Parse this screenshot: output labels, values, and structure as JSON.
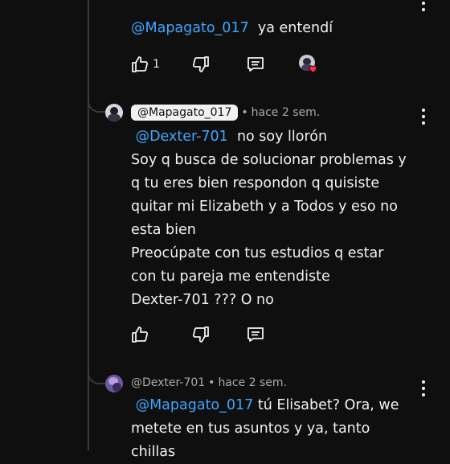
{
  "comments": [
    {
      "mention": "@Mapagato_017",
      "text": "ya entendí",
      "like_count": "1"
    },
    {
      "handle": "@Mapagato_017",
      "time": "hace 2 sem.",
      "mention": "@Dexter-701",
      "first_line_rest": "no soy llorón",
      "lines": [
        "Soy q busca de solucionar problemas y",
        "q tu eres bien respondon q quisiste",
        "quitar mi Elizabeth y a Todos y eso no",
        "esta bien",
        "Preocúpate con tus estudios q estar",
        "con tu pareja me entendiste",
        "Dexter-701 ??? O no"
      ]
    },
    {
      "handle": "@Dexter-701",
      "time": "hace 2 sem.",
      "mention": "@Mapagato_017",
      "first_line_rest": "tú Elisabet? Ora, we",
      "lines": [
        "metete en tus asuntos y ya, tanto",
        "chillas"
      ]
    }
  ],
  "meta_separator": "•",
  "icons": [
    "thumbs-up-icon",
    "thumbs-down-icon",
    "reply-icon",
    "creator-heart-icon",
    "more-vert-icon"
  ],
  "colors": {
    "background": "#0f0f0f",
    "mention": "#3ea6ff",
    "text": "#f1f1f1",
    "meta": "#aaaaaa"
  }
}
